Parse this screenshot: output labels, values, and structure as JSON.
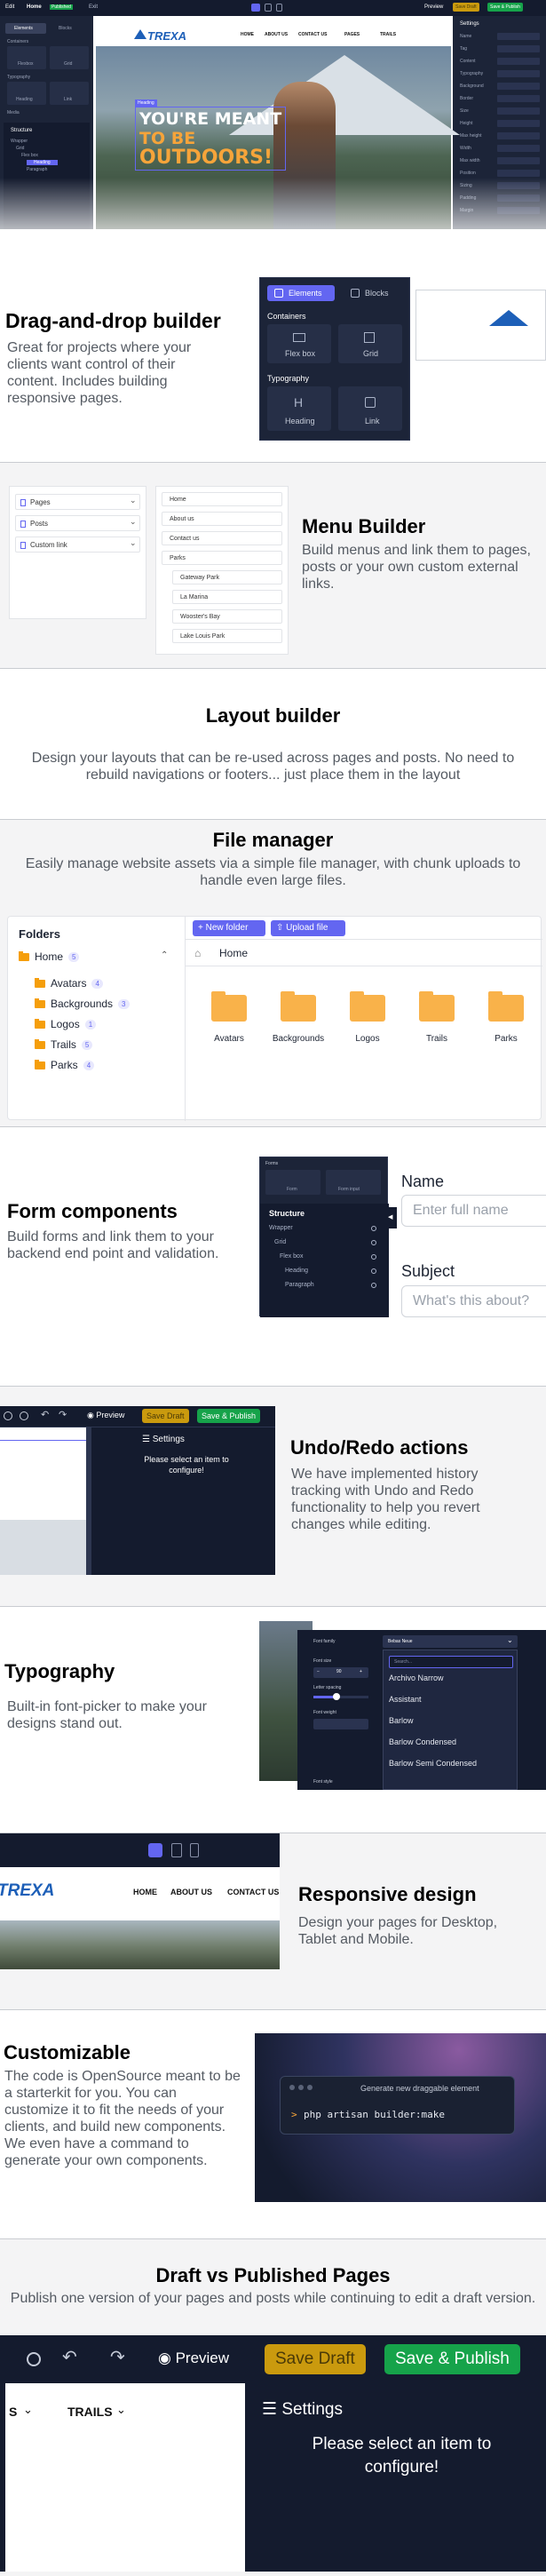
{
  "hero": {
    "builder_top": [
      "Edit",
      "Home",
      "Published",
      "Exit"
    ],
    "builder_right": [
      "Preview",
      "Save Draft",
      "Save & Publish"
    ],
    "left_panel": {
      "tabs": [
        "Elements",
        "Blocks"
      ],
      "groups": [
        "Containers",
        "Flexbox",
        "Grid",
        "Typography",
        "Heading",
        "Link",
        "Media"
      ],
      "structure_title": "Structure",
      "structure_items": [
        "Wrapper",
        "Grid",
        "Flex box",
        "Heading",
        "Paragraph"
      ]
    },
    "right_panel": {
      "title": "Settings",
      "fields": [
        "Name",
        "Tag",
        "Content",
        "Typography",
        "Background",
        "Border",
        "Size",
        "Height",
        "Max height",
        "Width",
        "Max width",
        "Position",
        "Sizing",
        "Padding",
        "Margin"
      ]
    },
    "site": {
      "logo": "TREXA",
      "nav": [
        "HOME",
        "ABOUT US",
        "CONTACT US",
        "PAGES",
        "TRAILS"
      ],
      "headline_line1": "YOU'RE MEANT",
      "headline_line2": "TO BE",
      "headline_line3": "OUTDOORS!",
      "tag": "Heading"
    }
  },
  "dnd": {
    "title": "Drag-and-drop builder",
    "text": "Great for projects where your clients want control of their content. Includes building responsive pages.",
    "tabs": [
      "Elements",
      "Blocks"
    ],
    "containers_label": "Containers",
    "containers": [
      "Flex box",
      "Grid"
    ],
    "typography_label": "Typography",
    "typography": [
      "Heading",
      "Link"
    ]
  },
  "menu": {
    "title": "Menu Builder",
    "text": "Build menus and link them to pages, posts or your own custom external links.",
    "sources": [
      "Pages",
      "Posts",
      "Custom link"
    ],
    "items": [
      "Home",
      "About us",
      "Contact us",
      "Parks",
      "Gateway Park",
      "La Marina",
      "Wooster's Bay",
      "Lake Louis Park"
    ]
  },
  "layout": {
    "title": "Layout builder",
    "text": "Design your layouts that can be re-used across pages and posts. No need to rebuild navigations or footers... just place them in the layout"
  },
  "files": {
    "title": "File manager",
    "text": "Easily manage website assets via a simple file manager, with chunk uploads to handle even large files.",
    "folders_label": "Folders",
    "home_label": "Home",
    "home_count": "5",
    "tree": [
      {
        "name": "Avatars",
        "count": "4"
      },
      {
        "name": "Backgrounds",
        "count": "3"
      },
      {
        "name": "Logos",
        "count": "1"
      },
      {
        "name": "Trails",
        "count": "5"
      },
      {
        "name": "Parks",
        "count": "4"
      }
    ],
    "new_folder": "New folder",
    "upload": "Upload file",
    "breadcrumb": "Home",
    "grid": [
      "Avatars",
      "Backgrounds",
      "Logos",
      "Trails",
      "Parks"
    ]
  },
  "forms": {
    "title": "Form components",
    "text": "Build forms and link them to your backend end point and validation.",
    "panel_label": "Forms",
    "panel_items": [
      "Form",
      "Form input"
    ],
    "structure_title": "Structure",
    "structure_items": [
      "Wrapper",
      "Grid",
      "Flex box",
      "Heading",
      "Paragraph"
    ],
    "name_label": "Name",
    "name_placeholder": "Enter full name",
    "subject_label": "Subject",
    "subject_placeholder": "What's this about?"
  },
  "undo": {
    "title": "Undo/Redo actions",
    "text": "We have implemented history tracking with Undo and Redo functionality to help you revert changes while editing.",
    "preview": "Preview",
    "save_draft": "Save Draft",
    "save_publish": "Save & Publish",
    "settings": "Settings",
    "empty_line1": "Please select an item to",
    "empty_line2": "configure!"
  },
  "typography": {
    "title": "Typography",
    "text": "Built-in font-picker to make your designs stand out.",
    "font_family_label": "Font family",
    "font_family_value": "Bebas Neue",
    "font_size_label": "Font size",
    "font_size_value": "90",
    "letter_spacing_label": "Letter spacing",
    "font_weight_label": "Font weight",
    "font_style_label": "Font style",
    "search_placeholder": "Search...",
    "options": [
      "Archivo Narrow",
      "Assistant",
      "Barlow",
      "Barlow Condensed",
      "Barlow Semi Condensed"
    ]
  },
  "responsive": {
    "title": "Responsive design",
    "text": "Design your pages for Desktop, Tablet and Mobile.",
    "logo": "TREXA",
    "nav": [
      "HOME",
      "ABOUT US",
      "CONTACT US"
    ]
  },
  "custom": {
    "title": "Customizable",
    "text": "The code is OpenSource meant to be a starterkit for you. You can customize it to fit the needs of your clients, and build new components. We even have a command to generate your own components.",
    "terminal_title": "Generate new draggable element",
    "command": "php artisan builder:make",
    "prompt": ">"
  },
  "draft": {
    "title": "Draft vs Published Pages",
    "text": "Publish one version of your pages and posts while continuing to edit a draft version.",
    "preview": "Preview",
    "save_draft": "Save Draft",
    "save_publish": "Save & Publish",
    "settings": "Settings",
    "nav_left": "S",
    "nav_trails": "TRAILS",
    "empty_line1": "Please select an item to",
    "empty_line2": "configure!"
  },
  "colors": {
    "navy": "#141b2e",
    "accent": "#6366f1",
    "green": "#16a34a",
    "yellow": "#ca9a0e",
    "orange": "#f59e0b"
  }
}
